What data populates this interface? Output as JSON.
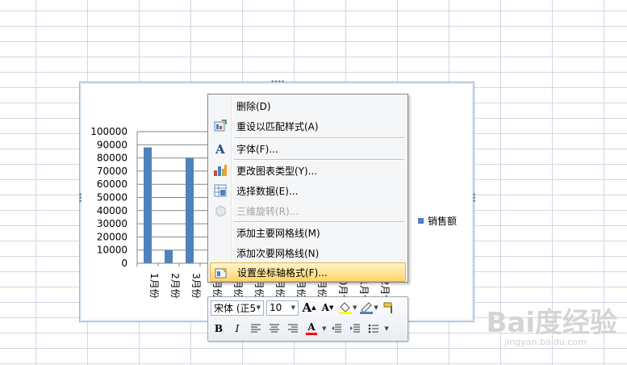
{
  "chart_data": {
    "type": "bar",
    "categories": [
      "1月份",
      "2月份",
      "3月份",
      "4月份",
      "5月份",
      "6月份",
      "7月份",
      "8月份",
      "9月份",
      "10月份",
      "11月份",
      "12月份"
    ],
    "series": [
      {
        "name": "销售额",
        "values": [
          88000,
          10000,
          80000,
          null,
          null,
          null,
          null,
          null,
          null,
          null,
          null,
          null
        ],
        "color": "#4f81bd"
      }
    ],
    "ylim": [
      0,
      100000
    ],
    "yticks": [
      "100000",
      "90000",
      "80000",
      "70000",
      "60000",
      "50000",
      "40000",
      "30000",
      "20000",
      "10000",
      "0"
    ],
    "grid": true,
    "legend": "right"
  },
  "context_menu": {
    "items": [
      {
        "label": "删除(D)",
        "icon": "",
        "disabled": false
      },
      {
        "label": "重设以匹配样式(A)",
        "icon": "reset-style-icon",
        "disabled": false
      },
      {
        "label": "字体(F)...",
        "icon": "font-icon",
        "disabled": false
      },
      {
        "label": "更改图表类型(Y)...",
        "icon": "chart-type-icon",
        "disabled": false
      },
      {
        "label": "选择数据(E)...",
        "icon": "select-data-icon",
        "disabled": false
      },
      {
        "label": "三维旋转(R)...",
        "icon": "3d-rotation-icon",
        "disabled": true
      },
      {
        "label": "添加主要网格线(M)",
        "icon": "",
        "disabled": false
      },
      {
        "label": "添加次要网格线(N)",
        "icon": "",
        "disabled": false
      },
      {
        "label": "设置坐标轴格式(F)...",
        "icon": "format-axis-icon",
        "disabled": false
      }
    ]
  },
  "mini_toolbar": {
    "font_name": "宋体 (正5",
    "font_size": "10",
    "grow_font": "A",
    "shrink_font": "A",
    "bold": "B",
    "italic": "I",
    "font_color": "A"
  },
  "watermark": {
    "logo": "Bai度经验",
    "url": "jingyan.baidu.com"
  },
  "colors": {
    "accent": "#4f81bd",
    "menu_hover": "#ffd567",
    "grid": "#d0d7e5"
  }
}
